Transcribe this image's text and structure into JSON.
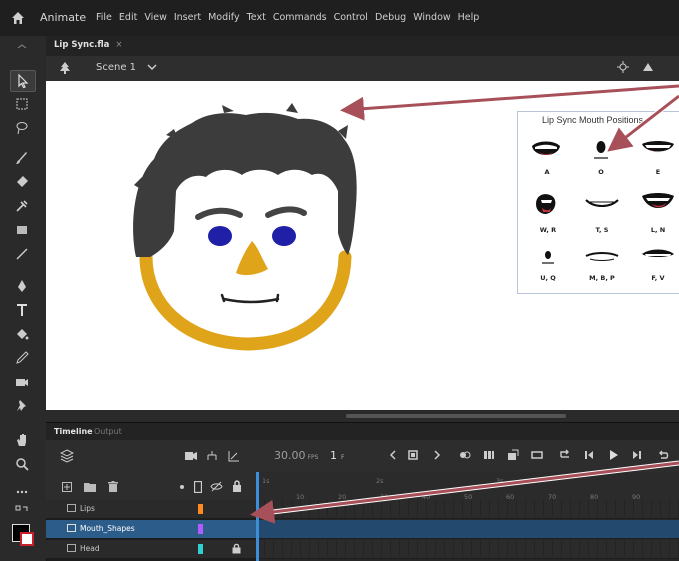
{
  "app": {
    "title": "Animate"
  },
  "menu": [
    "File",
    "Edit",
    "View",
    "Insert",
    "Modify",
    "Text",
    "Commands",
    "Control",
    "Debug",
    "Window",
    "Help"
  ],
  "document": {
    "tab_name": "Lip Sync.fla",
    "close": "×"
  },
  "scene": {
    "label": "Scene 1"
  },
  "stage": {
    "mouth_chart": {
      "title": "Lip Sync Mouth Positions",
      "cells": [
        "A",
        "O",
        "E",
        "W, R",
        "T, S",
        "L, N",
        "U, Q",
        "M, B, P",
        "F, V"
      ]
    }
  },
  "timeline": {
    "tab_timeline": "Timeline",
    "tab_output": "Output",
    "fps": "30.00",
    "fps_unit": "FPS",
    "current_frame": "1",
    "frame_unit": "F",
    "ruler_ticks": [
      "10",
      "20",
      "30",
      "40",
      "50",
      "60",
      "70",
      "80",
      "90"
    ],
    "ruler_seconds": [
      "1s",
      "2s",
      "3s"
    ],
    "layers": [
      {
        "name": "Lips",
        "color": "#ff8a1e",
        "selected": false,
        "locked": false
      },
      {
        "name": "Mouth_Shapes",
        "color": "#b25cff",
        "selected": true,
        "locked": false
      },
      {
        "name": "Head",
        "color": "#2fd0d0",
        "selected": false,
        "locked": true
      }
    ]
  },
  "colors": {
    "accent": "#3a8fd8",
    "selected_row": "#2c5d8a",
    "callout_arrow": "#a8505a",
    "hair": "#3c3c3c",
    "face_outline": "#e0a41a",
    "eyes": "#1f1fa8",
    "nose": "#e0a41a"
  }
}
